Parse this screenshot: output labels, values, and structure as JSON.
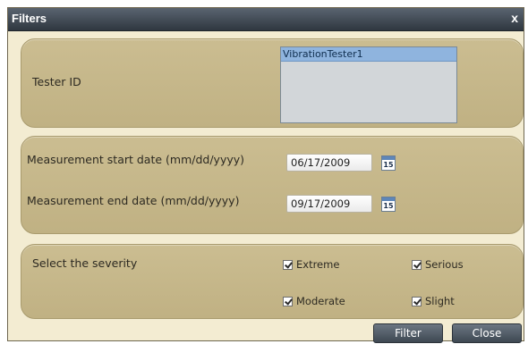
{
  "dialog": {
    "title": "Filters",
    "close_label": "x"
  },
  "tester": {
    "label": "Tester ID",
    "list_items": [
      "VibrationTester1"
    ],
    "selected_index": 0
  },
  "dates": {
    "start_label": "Measurement start date (mm/dd/yyyy)",
    "start_value": "06/17/2009",
    "end_label": "Measurement end date (mm/dd/yyyy)",
    "end_value": "09/17/2009",
    "calendar_icon_text": "15"
  },
  "severity": {
    "label": "Select the severity",
    "options": [
      {
        "label": "Extreme",
        "checked": true
      },
      {
        "label": "Serious",
        "checked": true
      },
      {
        "label": "Moderate",
        "checked": true
      },
      {
        "label": "Slight",
        "checked": true
      }
    ]
  },
  "buttons": {
    "filter_label": "Filter",
    "close_label": "Close"
  },
  "colors": {
    "titlebar": "#3a434d",
    "panel": "#c6b88a",
    "dialog_bg": "#f3ecd2",
    "selection": "#8fb4de"
  }
}
